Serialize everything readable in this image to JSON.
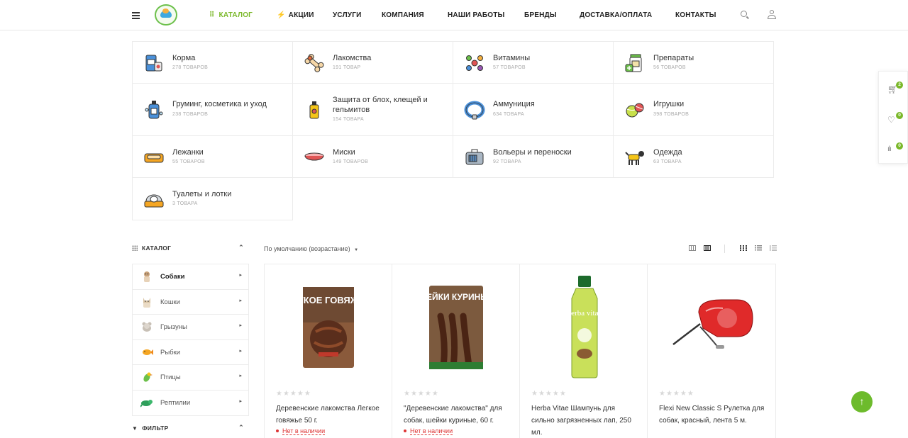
{
  "header": {
    "nav": [
      {
        "label": "Каталог"
      },
      {
        "label": "Акции"
      },
      {
        "label": "Услуги"
      },
      {
        "label": "Компания"
      },
      {
        "label": "Наши работы"
      },
      {
        "label": "Бренды"
      },
      {
        "label": "Доставка/оплата"
      },
      {
        "label": "Контакты"
      }
    ]
  },
  "categories": [
    {
      "title": "Корма",
      "count": "278 товаров",
      "icon": "food-bag-icon"
    },
    {
      "title": "Лакомства",
      "count": "191 товар",
      "icon": "bone-icon"
    },
    {
      "title": "Витамины",
      "count": "57 товаров",
      "icon": "vitamins-icon"
    },
    {
      "title": "Препараты",
      "count": "56 товаров",
      "icon": "medicine-icon"
    },
    {
      "title": "Груминг, косметика и уход",
      "count": "238 товаров",
      "icon": "shampoo-icon"
    },
    {
      "title": "Защита от блох, клещей и гельмитов",
      "count": "154 товара",
      "icon": "spray-icon"
    },
    {
      "title": "Аммуниция",
      "count": "634 товара",
      "icon": "collar-icon"
    },
    {
      "title": "Игрушки",
      "count": "398 товаров",
      "icon": "ball-icon"
    },
    {
      "title": "Лежанки",
      "count": "55 товаров",
      "icon": "bed-icon"
    },
    {
      "title": "Миски",
      "count": "149 товаров",
      "icon": "bowl-icon"
    },
    {
      "title": "Вольеры и переноски",
      "count": "92 товара",
      "icon": "carrier-icon"
    },
    {
      "title": "Одежда",
      "count": "63 товара",
      "icon": "dog-clothes-icon"
    },
    {
      "title": "Туалеты и лотки",
      "count": "3 товара",
      "icon": "litter-box-icon"
    }
  ],
  "sidebar": {
    "title": "Каталог",
    "items": [
      {
        "label": "Собаки",
        "icon": "dog-icon"
      },
      {
        "label": "Кошки",
        "icon": "cat-icon"
      },
      {
        "label": "Грызуны",
        "icon": "rodent-icon"
      },
      {
        "label": "Рыбки",
        "icon": "fish-icon"
      },
      {
        "label": "Птицы",
        "icon": "bird-icon"
      },
      {
        "label": "Рептилии",
        "icon": "reptile-icon"
      }
    ],
    "filter_title": "Фильтр"
  },
  "sort": {
    "label": "По умолчанию (возрастание)"
  },
  "products": [
    {
      "name": "Деревенские лакомства Легкое говяжье 50 г.",
      "stock": "Нет в наличии",
      "package_text": "ЛЕГКОЕ ГОВЯЖЬЕ"
    },
    {
      "name": "\"Деревенские лакомства\" для собак, шейки куриные, 60 г.",
      "stock": "Нет в наличии",
      "package_text": "ШЕЙКИ КУРИНЫЕ"
    },
    {
      "name": "Herba Vitae Шампунь для сильно загрязненных лап, 250 мл.",
      "stock": "",
      "package_text": "herba vitae"
    },
    {
      "name": "Flexi New Classic S Рулетка для собак, красный, лента 5 м.",
      "stock": "",
      "package_text": ""
    }
  ],
  "float_panel": {
    "cart_count": "2",
    "wishlist_count": "0",
    "compare_count": "0"
  },
  "colors": {
    "accent": "#7ab829",
    "out_of_stock": "#dd3333"
  }
}
